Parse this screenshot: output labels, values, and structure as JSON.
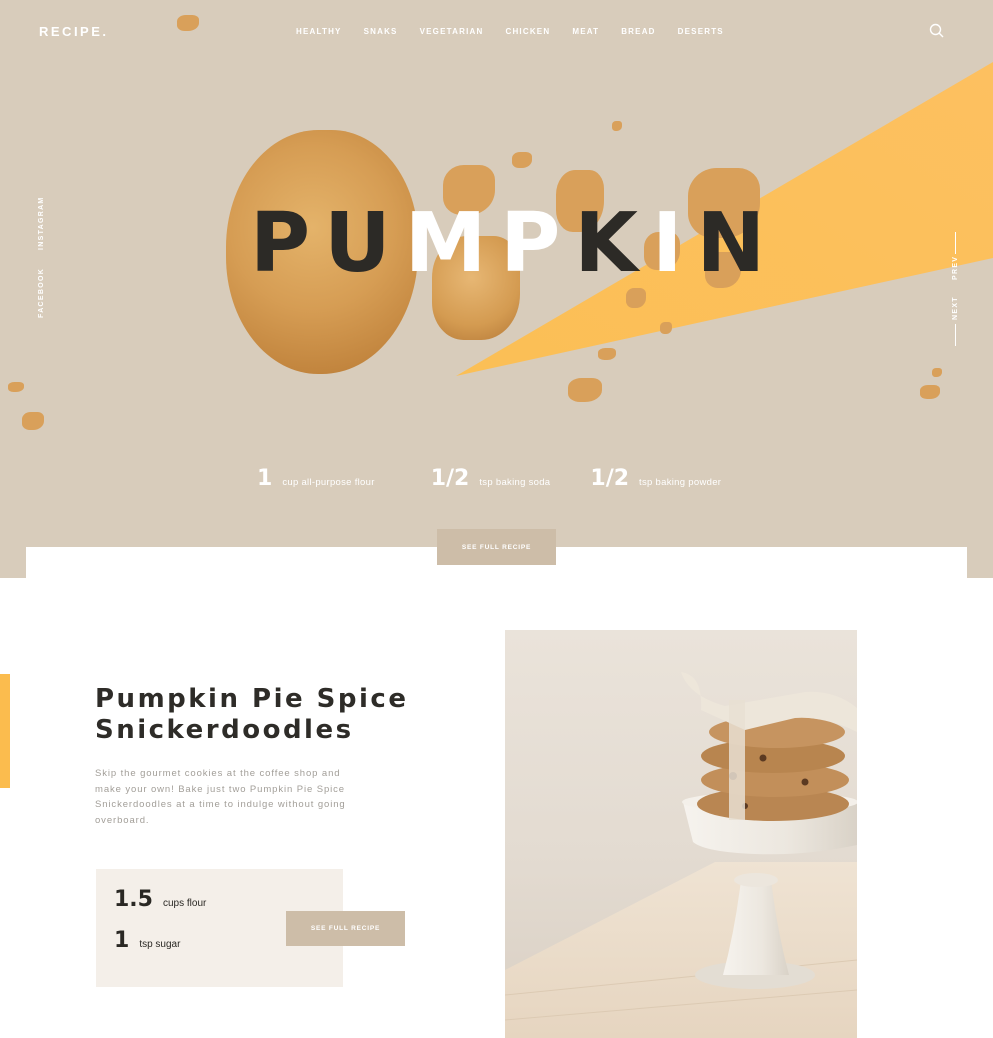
{
  "brand": {
    "logo": "RECIPE."
  },
  "nav": {
    "items": [
      "HEALTHY",
      "SNAKS",
      "VEGETARIAN",
      "CHICKEN",
      "MEAT",
      "BREAD",
      "DESERTS"
    ]
  },
  "icons": {
    "search": "search-icon"
  },
  "social": {
    "instagram": "INSTAGRAM",
    "facebook": "FACEBOOK"
  },
  "pager": {
    "prev": "PREV",
    "next": "NEXT"
  },
  "hero": {
    "title_dark_1": "PU",
    "title_white_1": "MP",
    "title_dark_2": "K",
    "title_white_2": "I",
    "title_dark_3": "N",
    "ingredients": [
      {
        "amount": "1",
        "desc": "cup all-purpose flour"
      },
      {
        "amount": "1/2",
        "desc": "tsp baking soda"
      },
      {
        "amount": "1/2",
        "desc": "tsp baking powder"
      }
    ],
    "button": "SEE FULL RECIPE"
  },
  "recipe": {
    "title_line1": "Pumpkin Pie Spice",
    "title_line2": "Snickerdoodles",
    "description": "Skip the gourmet cookies at the coffee shop and make your own! Bake just two Pumpkin Pie Spice Snickerdoodles at a time to indulge without going overboard.",
    "ingredients": [
      {
        "amount": "1.5",
        "desc": "cups flour"
      },
      {
        "amount": "1",
        "desc": "tsp sugar"
      }
    ],
    "button": "SEE FULL RECIPE"
  },
  "colors": {
    "hero_bg": "#d8ccbb",
    "accent": "#fbbc4e",
    "button_bg": "#cdbda8",
    "title_dark": "#2e2c28"
  }
}
